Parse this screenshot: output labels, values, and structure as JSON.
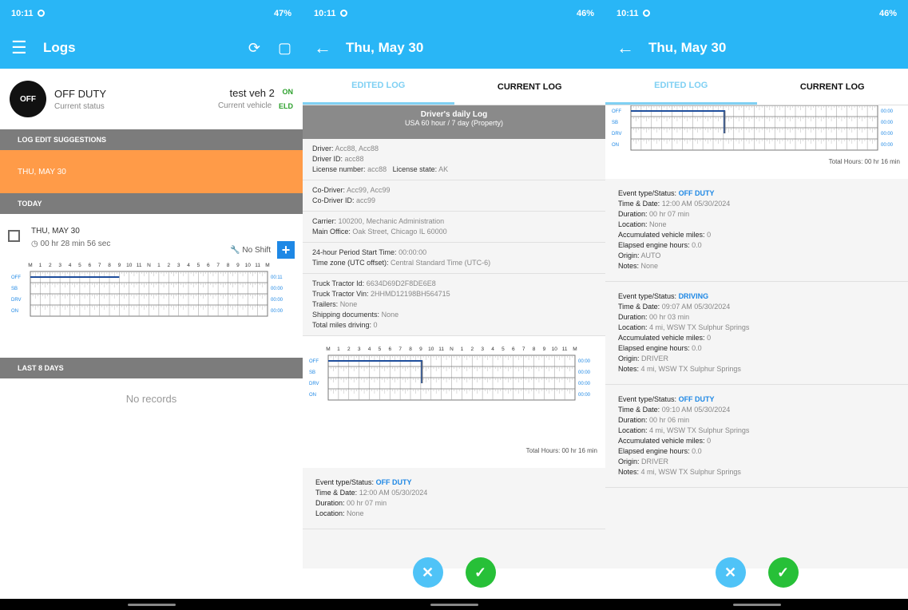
{
  "status_bar": {
    "time": "10:11",
    "battery_left": "47%",
    "battery_right": "46%"
  },
  "panel1": {
    "title": "Logs",
    "status": {
      "badge": "OFF",
      "label": "OFF DUTY",
      "sub": "Current status"
    },
    "vehicle": {
      "name": "test veh 2",
      "sub": "Current vehicle",
      "eld_top": "ON",
      "eld_bottom": "ELD"
    },
    "suggestions_header": "LOG EDIT SUGGESTIONS",
    "suggestion_item": "THU, MAY 30",
    "today_header": "TODAY",
    "today": {
      "date": "THU, MAY 30",
      "duration": "00 hr 28 min 56 sec",
      "shift": "No Shift"
    },
    "last_header": "LAST 8 DAYS",
    "no_records": "No records"
  },
  "panel2": {
    "title": "Thu, May 30",
    "tab_edited": "EDITED LOG",
    "tab_current": "CURRENT LOG",
    "header_title": "Driver's daily Log",
    "header_sub": "USA 60 hour / 7 day (Property)",
    "driver": {
      "driver_lbl": "Driver:",
      "driver": "Acc88, Acc88",
      "id_lbl": "Driver ID:",
      "id": "acc88",
      "lic_lbl": "License number:",
      "lic": "acc88",
      "state_lbl": "License state:",
      "state": "AK"
    },
    "codriver": {
      "name_lbl": "Co-Driver:",
      "name": "Acc99, Acc99",
      "id_lbl": "Co-Driver ID:",
      "id": "acc99"
    },
    "carrier": {
      "carrier_lbl": "Carrier:",
      "carrier": "100200, Mechanic Administration",
      "office_lbl": "Main Office:",
      "office": "Oak Street, Chicago IL 60000"
    },
    "period": {
      "start_lbl": "24-hour Period Start Time:",
      "start": "00:00:00",
      "tz_lbl": "Time zone (UTC offset):",
      "tz": "Central Standard Time (UTC-6)"
    },
    "truck": {
      "id_lbl": "Truck Tractor Id:",
      "id": "6634D69D2F8DE6E8",
      "vin_lbl": "Truck Tractor Vin:",
      "vin": "2HHMD12198BH564715",
      "trailers_lbl": "Trailers:",
      "trailers": "None",
      "ship_lbl": "Shipping documents:",
      "ship": "None",
      "miles_lbl": "Total miles driving:",
      "miles": "0"
    },
    "total_hours": "Total Hours: 00 hr 16 min",
    "event": {
      "type_lbl": "Event type/Status:",
      "type": "OFF DUTY",
      "time_lbl": "Time & Date:",
      "time": "12:00 AM 05/30/2024",
      "dur_lbl": "Duration:",
      "dur": "00 hr 07 min",
      "loc_lbl": "Location:",
      "loc": "None"
    }
  },
  "panel3": {
    "title": "Thu, May 30",
    "tab_edited": "EDITED LOG",
    "tab_current": "CURRENT LOG",
    "total_hours": "Total Hours: 00 hr 16 min",
    "events": [
      {
        "type_lbl": "Event type/Status:",
        "type": "OFF DUTY",
        "time_lbl": "Time & Date:",
        "time": "12:00 AM 05/30/2024",
        "dur_lbl": "Duration:",
        "dur": "00 hr 07 min",
        "loc_lbl": "Location:",
        "loc": "None",
        "miles_lbl": "Accumulated vehicle miles:",
        "miles": "0",
        "eng_lbl": "Elapsed engine hours:",
        "eng": "0.0",
        "orig_lbl": "Origin:",
        "orig": "AUTO",
        "notes_lbl": "Notes:",
        "notes": "None"
      },
      {
        "type_lbl": "Event type/Status:",
        "type": "DRIVING",
        "time_lbl": "Time & Date:",
        "time": "09:07 AM 05/30/2024",
        "dur_lbl": "Duration:",
        "dur": "00 hr 03 min",
        "loc_lbl": "Location:",
        "loc": "4 mi, WSW TX Sulphur Springs",
        "miles_lbl": "Accumulated vehicle miles:",
        "miles": "0",
        "eng_lbl": "Elapsed engine hours:",
        "eng": "0.0",
        "orig_lbl": "Origin:",
        "orig": "DRIVER",
        "notes_lbl": "Notes:",
        "notes": "4 mi, WSW TX Sulphur Springs"
      },
      {
        "type_lbl": "Event type/Status:",
        "type": "OFF DUTY",
        "time_lbl": "Time & Date:",
        "time": "09:10 AM 05/30/2024",
        "dur_lbl": "Duration:",
        "dur": "00 hr 06 min",
        "loc_lbl": "Location:",
        "loc": "4 mi, WSW TX Sulphur Springs",
        "miles_lbl": "Accumulated vehicle miles:",
        "miles": "0",
        "eng_lbl": "Elapsed engine hours:",
        "eng": "0.0",
        "orig_lbl": "Origin:",
        "orig": "DRIVER",
        "notes_lbl": "Notes:",
        "notes": "4 mi, WSW TX Sulphur Springs"
      }
    ]
  },
  "grid": {
    "rows": [
      "OFF",
      "SB",
      "DRV",
      "ON"
    ],
    "hour_labels": [
      "M",
      "1",
      "2",
      "3",
      "4",
      "5",
      "6",
      "7",
      "8",
      "9",
      "10",
      "11",
      "N",
      "1",
      "2",
      "3",
      "4",
      "5",
      "6",
      "7",
      "8",
      "9",
      "10",
      "11",
      "M"
    ],
    "totals_p1": [
      "00:11",
      "00:00",
      "00:00",
      "00:00"
    ],
    "totals": [
      "00:00",
      "00:00",
      "00:00",
      "00:00"
    ]
  },
  "colors": {
    "primary": "#29b6f6",
    "accent": "#ff9b48",
    "ok": "#27c038",
    "line": "#1f4e9c"
  }
}
